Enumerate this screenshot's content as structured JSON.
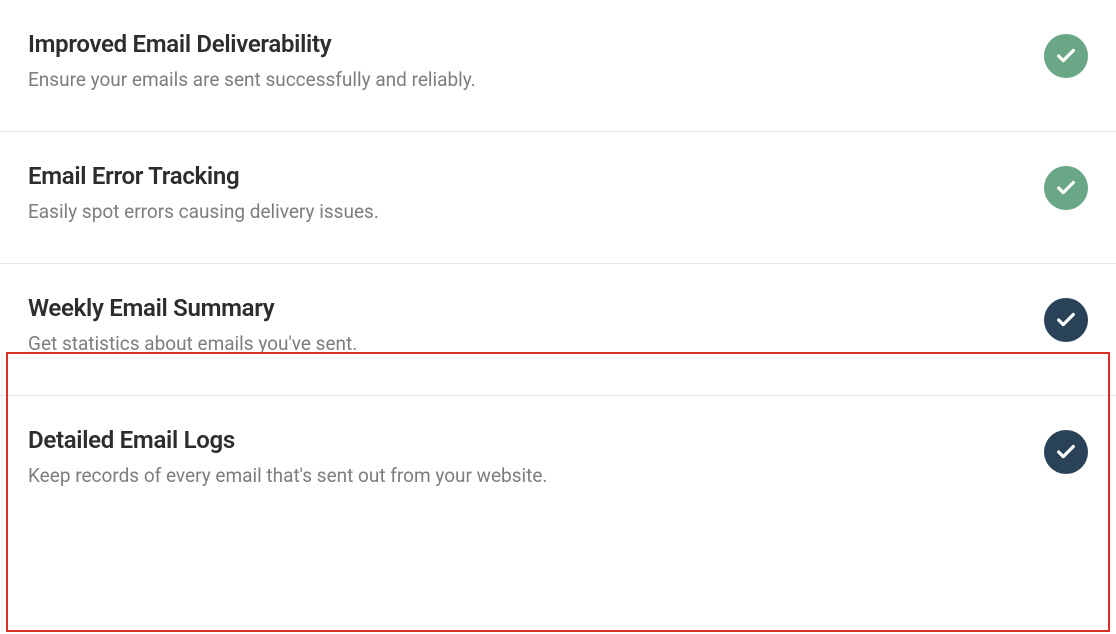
{
  "features": [
    {
      "title": "Improved Email Deliverability",
      "description": "Ensure your emails are sent successfully and reliably.",
      "badge_color": "green"
    },
    {
      "title": "Email Error Tracking",
      "description": "Easily spot errors causing delivery issues.",
      "badge_color": "green"
    },
    {
      "title": "Weekly Email Summary",
      "description": "Get statistics about emails you've sent.",
      "badge_color": "navy"
    },
    {
      "title": "Detailed Email Logs",
      "description": "Keep records of every email that's sent out from your website.",
      "badge_color": "navy"
    }
  ],
  "colors": {
    "green": "#6aa786",
    "navy": "#2a4258",
    "highlight": "#d93025"
  }
}
